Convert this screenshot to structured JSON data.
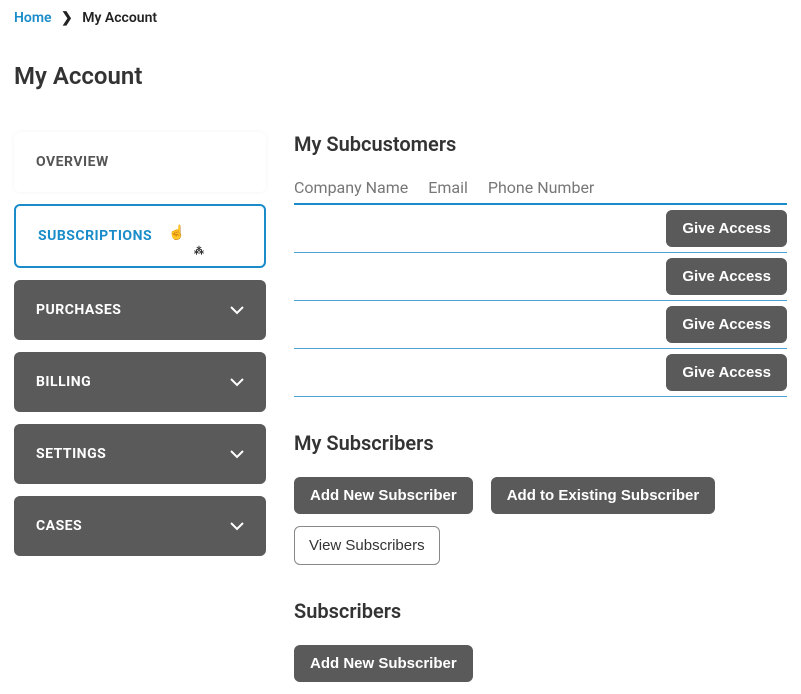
{
  "breadcrumb": {
    "home": "Home",
    "current": "My Account"
  },
  "page_title": "My Account",
  "sidebar": {
    "overview": "OVERVIEW",
    "subscriptions": "SUBSCRIPTIONS",
    "purchases": "PURCHASES",
    "billing": "BILLING",
    "settings": "SETTINGS",
    "cases": "CASES"
  },
  "main": {
    "subcustomers_title": "My Subcustomers",
    "columns": {
      "company": "Company Name",
      "email": "Email",
      "phone": "Phone Number"
    },
    "give_access_label": "Give Access",
    "subscribers_title": "My Subscribers",
    "add_new_subscriber": "Add New Subscriber",
    "add_to_existing": "Add to Existing Subscriber",
    "view_subscribers": "View Subscribers",
    "subscribers_section_title": "Subscribers",
    "add_new_subscriber2": "Add New Subscriber"
  }
}
